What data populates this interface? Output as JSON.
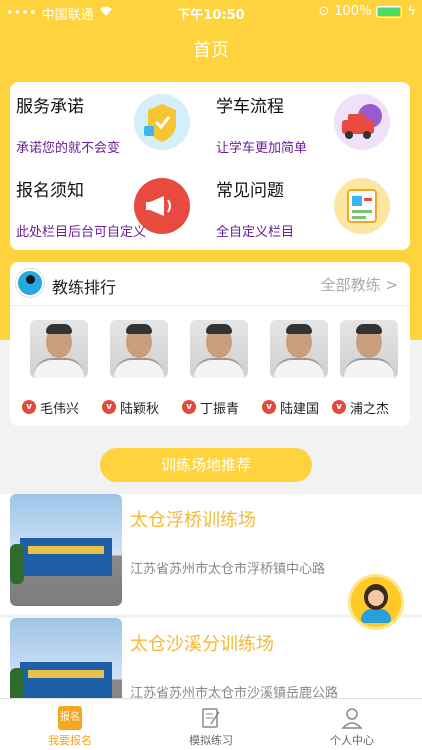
{
  "status_bar": {
    "carrier": "中国联通",
    "time": "下午10:50",
    "battery": "100%"
  },
  "header": {
    "title": "首页"
  },
  "services": [
    {
      "title": "服务承诺",
      "subtitle": "承诺您的就不会变",
      "icon": "shield-icon",
      "color": "#3bb5ef"
    },
    {
      "title": "学车流程",
      "subtitle": "让学车更加简单",
      "icon": "car-icon",
      "color": "#9b59d0"
    },
    {
      "title": "报名须知",
      "subtitle": "此处栏目后台可自定义",
      "icon": "megaphone-icon",
      "color": "#e84a3f"
    },
    {
      "title": "常见问题",
      "subtitle": "全自定义栏目",
      "icon": "question-board-icon",
      "color": "#f5c542"
    }
  ],
  "coach": {
    "title": "教练排行",
    "all_label": "全部教练 >",
    "coaches": [
      {
        "name": "毛伟兴",
        "badge": "v"
      },
      {
        "name": "陆颖秋",
        "badge": "v"
      },
      {
        "name": "丁振青",
        "badge": "v"
      },
      {
        "name": "陆建国",
        "badge": "v"
      },
      {
        "name": "浦之杰",
        "badge": "v"
      }
    ]
  },
  "recommend": {
    "label": "训练场地推荐"
  },
  "venues": [
    {
      "name": "太仓浮桥训练场",
      "address": "江苏省苏州市太仓市浮桥镇中心路"
    },
    {
      "name": "太仓沙溪分训练场",
      "address": "江苏省苏州市太仓市沙溪镇岳鹿公路"
    }
  ],
  "tabbar": [
    {
      "label": "我要报名",
      "icon": "sign-up-icon",
      "icon_text": "报名",
      "active": true
    },
    {
      "label": "模拟练习",
      "icon": "practice-icon",
      "active": false
    },
    {
      "label": "个人中心",
      "icon": "person-icon",
      "active": false
    }
  ],
  "colors": {
    "accent": "#ffd33d",
    "venue_title": "#f5b932",
    "subtitle": "#6a1f9a",
    "active_tab": "#f5a623"
  }
}
